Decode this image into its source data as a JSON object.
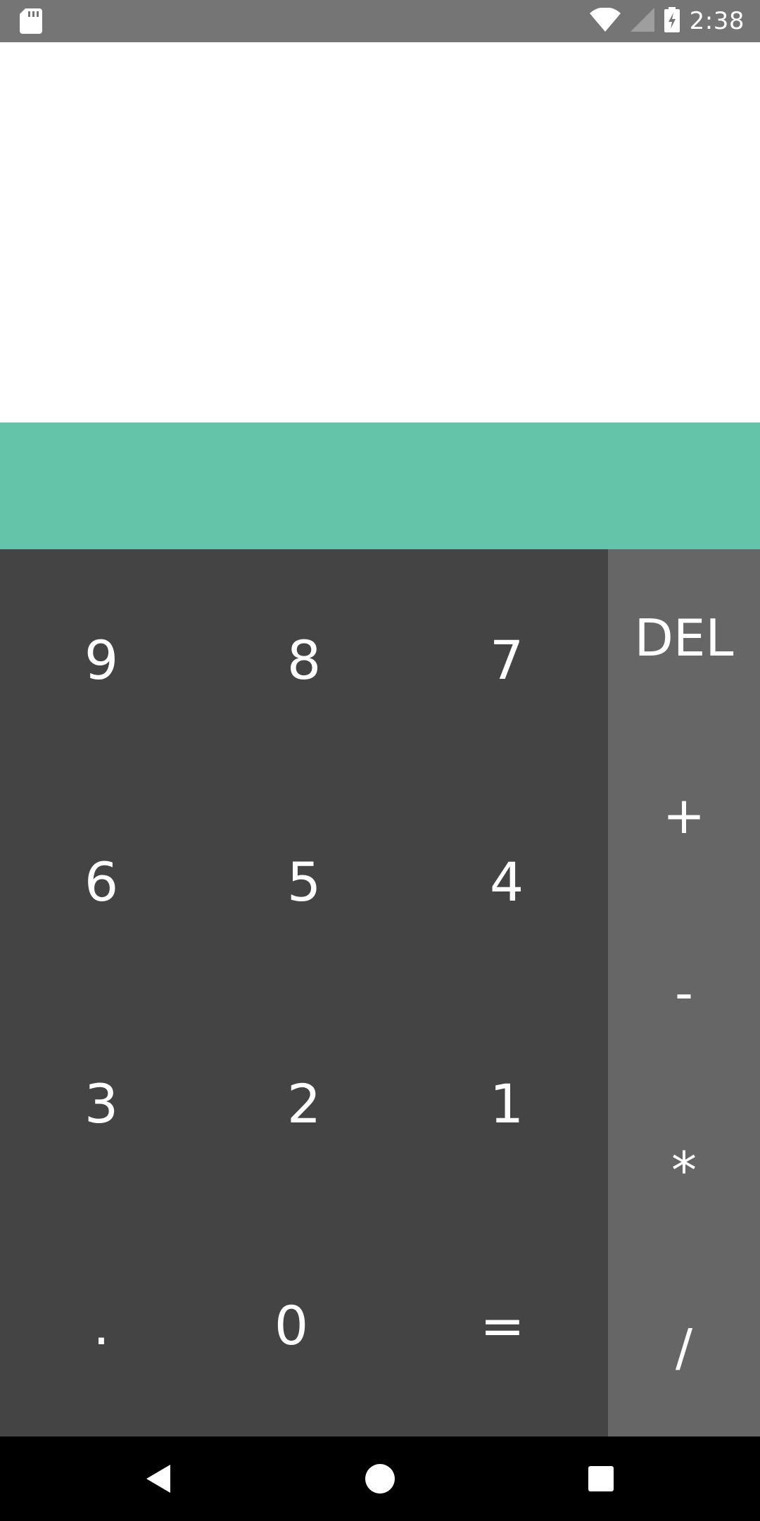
{
  "status_bar": {
    "time": "2:38",
    "icons": [
      "sd-card-icon",
      "wifi-icon",
      "cell-signal-icon",
      "battery-charging-icon"
    ]
  },
  "display": {
    "expression": "",
    "result": ""
  },
  "keypad": {
    "rows": [
      [
        "9",
        "8",
        "7"
      ],
      [
        "6",
        "5",
        "4"
      ],
      [
        "3",
        "2",
        "1"
      ],
      [
        ".",
        "0",
        "="
      ]
    ]
  },
  "operators": {
    "delete": "DEL",
    "add": "+",
    "subtract": "-",
    "multiply": "*",
    "divide": "/"
  },
  "colors": {
    "status_bar": "#757575",
    "display_bg": "#ffffff",
    "result_bar": "#64c4a9",
    "keypad_bg": "#444444",
    "operators_bg": "#666666",
    "nav_bar": "#000000"
  },
  "nav_bar": {
    "icons": [
      "back-icon",
      "home-icon",
      "recents-icon"
    ]
  }
}
